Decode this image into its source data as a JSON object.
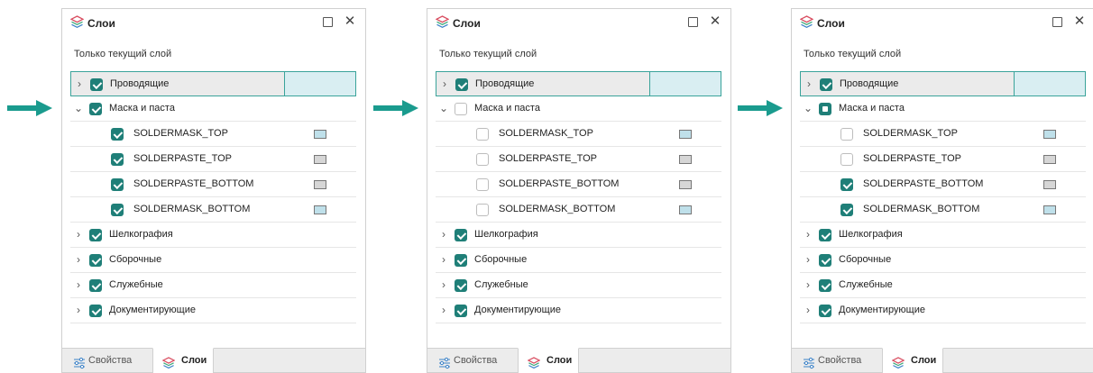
{
  "colors": {
    "accent": "#1f7f78",
    "arrow": "#1a9b8e",
    "select_border": "#3aa39a",
    "swatch_blue": "#bfe0ea",
    "swatch_gray": "#d6d6d6",
    "sel_fill": "#d9eef2"
  },
  "panels": [
    {
      "title": "Слои",
      "subtitle": "Только текущий слой",
      "tabs": {
        "properties": "Свойства",
        "layers": "Слои"
      },
      "groups": {
        "conductive": {
          "label": "Проводящие",
          "state": "checked",
          "expanded": false
        },
        "mask": {
          "label": "Маска и паста",
          "state": "checked",
          "expanded": true
        },
        "silk": {
          "label": "Шелкография",
          "state": "checked",
          "expanded": false
        },
        "assembly": {
          "label": "Сборочные",
          "state": "checked",
          "expanded": false
        },
        "service": {
          "label": "Служебные",
          "state": "checked",
          "expanded": false
        },
        "document": {
          "label": "Документирующие",
          "state": "checked",
          "expanded": false
        }
      },
      "layers": {
        "soldermask_top": {
          "label": "SOLDERMASK_TOP",
          "state": "checked",
          "color": "blue"
        },
        "solderpaste_top": {
          "label": "SOLDERPASTE_TOP",
          "state": "checked",
          "color": "gray"
        },
        "solderpaste_bottom": {
          "label": "SOLDERPASTE_BOTTOM",
          "state": "checked",
          "color": "gray"
        },
        "soldermask_bottom": {
          "label": "SOLDERMASK_BOTTOM",
          "state": "checked",
          "color": "blue"
        }
      }
    },
    {
      "title": "Слои",
      "subtitle": "Только текущий слой",
      "tabs": {
        "properties": "Свойства",
        "layers": "Слои"
      },
      "groups": {
        "conductive": {
          "label": "Проводящие",
          "state": "checked",
          "expanded": false
        },
        "mask": {
          "label": "Маска и паста",
          "state": "unchecked",
          "expanded": true
        },
        "silk": {
          "label": "Шелкография",
          "state": "checked",
          "expanded": false
        },
        "assembly": {
          "label": "Сборочные",
          "state": "checked",
          "expanded": false
        },
        "service": {
          "label": "Служебные",
          "state": "checked",
          "expanded": false
        },
        "document": {
          "label": "Документирующие",
          "state": "checked",
          "expanded": false
        }
      },
      "layers": {
        "soldermask_top": {
          "label": "SOLDERMASK_TOP",
          "state": "unchecked",
          "color": "blue"
        },
        "solderpaste_top": {
          "label": "SOLDERPASTE_TOP",
          "state": "unchecked",
          "color": "gray"
        },
        "solderpaste_bottom": {
          "label": "SOLDERPASTE_BOTTOM",
          "state": "unchecked",
          "color": "gray"
        },
        "soldermask_bottom": {
          "label": "SOLDERMASK_BOTTOM",
          "state": "unchecked",
          "color": "blue"
        }
      }
    },
    {
      "title": "Слои",
      "subtitle": "Только текущий слой",
      "tabs": {
        "properties": "Свойства",
        "layers": "Слои"
      },
      "groups": {
        "conductive": {
          "label": "Проводящие",
          "state": "checked",
          "expanded": false
        },
        "mask": {
          "label": "Маска и паста",
          "state": "partial",
          "expanded": true
        },
        "silk": {
          "label": "Шелкография",
          "state": "checked",
          "expanded": false
        },
        "assembly": {
          "label": "Сборочные",
          "state": "checked",
          "expanded": false
        },
        "service": {
          "label": "Служебные",
          "state": "checked",
          "expanded": false
        },
        "document": {
          "label": "Документирующие",
          "state": "checked",
          "expanded": false
        }
      },
      "layers": {
        "soldermask_top": {
          "label": "SOLDERMASK_TOP",
          "state": "unchecked",
          "color": "blue"
        },
        "solderpaste_top": {
          "label": "SOLDERPASTE_TOP",
          "state": "unchecked",
          "color": "gray"
        },
        "solderpaste_bottom": {
          "label": "SOLDERPASTE_BOTTOM",
          "state": "checked",
          "color": "gray"
        },
        "soldermask_bottom": {
          "label": "SOLDERMASK_BOTTOM",
          "state": "checked",
          "color": "blue"
        }
      }
    }
  ]
}
